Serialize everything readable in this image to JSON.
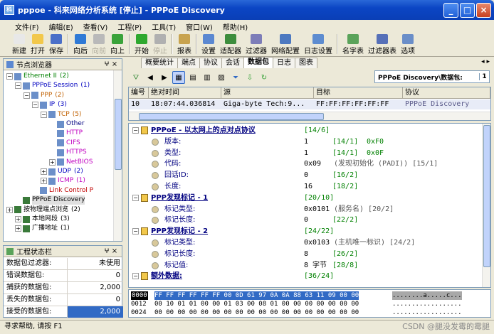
{
  "window": {
    "title": "pppoe - 科来网络分析系统 [停止] - PPPoE Discovery",
    "buttons": [
      "_",
      "□",
      "×"
    ]
  },
  "menu": [
    "文件(F)",
    "编辑(E)",
    "查看(V)",
    "工程(P)",
    "工具(T)",
    "窗口(W)",
    "帮助(H)"
  ],
  "toolbar": [
    {
      "label": "新建",
      "icon": "new-icon",
      "color": "#e8e8e8"
    },
    {
      "label": "打开",
      "icon": "open-icon",
      "color": "#f2c84b"
    },
    {
      "label": "保存",
      "icon": "save-icon",
      "color": "#4a6fc8"
    },
    {
      "sep": true
    },
    {
      "label": "向后",
      "icon": "back-icon",
      "color": "#2f7ad6"
    },
    {
      "label": "向前",
      "icon": "forward-icon",
      "color": "#b9b9b9",
      "disabled": true
    },
    {
      "label": "向上",
      "icon": "up-icon",
      "color": "#3aa33a"
    },
    {
      "sep": true
    },
    {
      "label": "开始",
      "icon": "start-icon",
      "color": "#2ea82e"
    },
    {
      "label": "停止",
      "icon": "stop-icon",
      "color": "#b0b0b0",
      "disabled": true
    },
    {
      "sep": true
    },
    {
      "label": "报表",
      "icon": "report-icon",
      "color": "#c8a34e"
    },
    {
      "sep": true
    },
    {
      "label": "设置",
      "icon": "settings-icon",
      "color": "#5b88d1"
    },
    {
      "label": "适配器",
      "icon": "adapter-icon",
      "color": "#3d8d3d"
    },
    {
      "label": "过滤器",
      "icon": "filter-icon",
      "color": "#7d7db8"
    },
    {
      "label": "网络配置",
      "icon": "netconfig-icon",
      "color": "#4d79c0"
    },
    {
      "label": "日志设置",
      "icon": "logsettings-icon",
      "color": "#5d8cd0"
    },
    {
      "sep": true
    },
    {
      "label": "名字表",
      "icon": "nametable-icon",
      "color": "#5aa35a"
    },
    {
      "label": "过滤器表",
      "icon": "filtertable-icon",
      "color": "#5670b8"
    },
    {
      "label": "选项",
      "icon": "options-icon",
      "color": "#6a8ec8"
    }
  ],
  "node_pane": {
    "title": "节点浏览器"
  },
  "tree": [
    {
      "label": "Ethernet II",
      "count": "(2)",
      "indent": 0,
      "color": "#008000",
      "box": "-"
    },
    {
      "label": "PPPoE Session",
      "count": "(1)",
      "indent": 1,
      "color": "#0000c0",
      "box": "-"
    },
    {
      "label": "PPP",
      "count": "(2)",
      "indent": 2,
      "color": "#c06000",
      "box": "-"
    },
    {
      "label": "IP",
      "count": "(3)",
      "indent": 3,
      "color": "#0000c0",
      "box": "-"
    },
    {
      "label": "TCP",
      "count": "(5)",
      "indent": 4,
      "color": "#c06000",
      "box": "-"
    },
    {
      "label": "Other",
      "count": "",
      "indent": 5,
      "color": "#000080",
      "box": ""
    },
    {
      "label": "HTTP",
      "count": "",
      "indent": 5,
      "color": "#c000c0",
      "box": ""
    },
    {
      "label": "CIFS",
      "count": "",
      "indent": 5,
      "color": "#c000c0",
      "box": ""
    },
    {
      "label": "HTTPS",
      "count": "",
      "indent": 5,
      "color": "#c000c0",
      "box": ""
    },
    {
      "label": "NetBIOS",
      "count": "",
      "indent": 5,
      "color": "#c000c0",
      "box": "+"
    },
    {
      "label": "UDP",
      "count": "(2)",
      "indent": 4,
      "color": "#0000c0",
      "box": "+"
    },
    {
      "label": "ICMP",
      "count": "(1)",
      "indent": 4,
      "color": "#c000c0",
      "box": "+"
    },
    {
      "label": "Link Control P",
      "count": "",
      "indent": 3,
      "color": "#c00000",
      "box": ""
    },
    {
      "label": "PPPoE Discovery",
      "count": "",
      "indent": 1,
      "color": "#000000",
      "box": "",
      "selected": true
    },
    {
      "label": "按物理端点浏览",
      "count": "(2)",
      "indent": 0,
      "color": "#000000",
      "box": "+"
    },
    {
      "label": "本地网段",
      "count": "(3)",
      "indent": 1,
      "color": "#000000",
      "box": "+"
    },
    {
      "label": "广播地址",
      "count": "(1)",
      "indent": 1,
      "color": "#000000",
      "box": "+"
    }
  ],
  "state_pane": {
    "title": "工程状态栏",
    "rows": [
      {
        "k": "数据包过滤器:",
        "v": "未使用"
      },
      {
        "k": "错误数据包:",
        "v": "0"
      },
      {
        "k": "捕获的数据包:",
        "v": "2,000"
      },
      {
        "k": "丢失的数据包:",
        "v": "0"
      },
      {
        "k": "接受的数据包:",
        "v": "2,000",
        "selected": true
      }
    ]
  },
  "tabs": [
    "概要统计",
    "端点",
    "协议",
    "会话",
    "数据包",
    "日志",
    "图表"
  ],
  "active_tab": "数据包",
  "path": {
    "label": "PPPoE Discovery\\数据包:",
    "num": "1"
  },
  "packet_table": {
    "headers": [
      "编号",
      "绝对时间",
      "源",
      "目标",
      "协议"
    ],
    "rows": [
      [
        "10",
        "18:07:44.036814",
        "Giga-byte Tech:9...",
        "FF:FF:FF:FF:FF:FF",
        "PPPoE Discovery"
      ]
    ]
  },
  "decode": [
    {
      "t": "h",
      "name": "PPPoE - 以太网上的点对点协议",
      "off": "[14/6]"
    },
    {
      "t": "f",
      "name": "版本:",
      "val": "1",
      "off": "[14/1]",
      "extra": "0xF0"
    },
    {
      "t": "f",
      "name": "类型:",
      "val": "1",
      "off": "[14/1]",
      "extra": "0x0F"
    },
    {
      "t": "f",
      "name": "代码:",
      "val": "0x09",
      "off": "",
      "extra": "(发现初始化 (PADI))  [15/1]"
    },
    {
      "t": "f",
      "name": "回话ID:",
      "val": "0",
      "off": "[16/2]",
      "extra": ""
    },
    {
      "t": "f",
      "name": "长度:",
      "val": "16",
      "off": "[18/2]",
      "extra": ""
    },
    {
      "t": "h",
      "name": "PPP发现标记 - 1",
      "off": "[20/10]"
    },
    {
      "t": "f",
      "name": "标记类型:",
      "val": "0x0101",
      "off": "",
      "extra": "(服务名)  [20/2]"
    },
    {
      "t": "f",
      "name": "标记长度:",
      "val": "0",
      "off": "[22/2]",
      "extra": ""
    },
    {
      "t": "h",
      "name": "PPP发现标记 - 2",
      "off": "[24/22]"
    },
    {
      "t": "f",
      "name": "标记类型:",
      "val": "0x0103",
      "off": "",
      "extra": "(主机唯一标识)  [24/2]"
    },
    {
      "t": "f",
      "name": "标记长度:",
      "val": "8",
      "off": "[26/2]",
      "extra": ""
    },
    {
      "t": "f",
      "name": "标记值:",
      "val": "8 字节",
      "off": "[28/8]",
      "extra": ""
    },
    {
      "t": "h",
      "name": "额外数据:",
      "off": "[36/24]"
    }
  ],
  "hex": [
    {
      "addr": "0000",
      "bytes": "FF FF FF FF FF FF 00 0D 61 97 0A 0A 88 63 11 09 00 00",
      "ascii": "........a.....c..."
    },
    {
      "addr": "0012",
      "bytes": "00 10 01 01 00 00 01 03 00 08 01 00 00 00 00 00 00 00",
      "ascii": ".................."
    },
    {
      "addr": "0024",
      "bytes": "00 00 00 00 00 00 00 00 00 00 00 00 00 00 00 00 00 00",
      "ascii": ".................."
    }
  ],
  "status": "寻求帮助, 请按 F1",
  "watermark": "CSDN @腿没发霉的霉腿",
  "colors": {
    "titlebar": "#0b45c4",
    "selection": "#316ac5",
    "header_name": "#000080",
    "offset": "#008000",
    "value_green": "#008000"
  }
}
